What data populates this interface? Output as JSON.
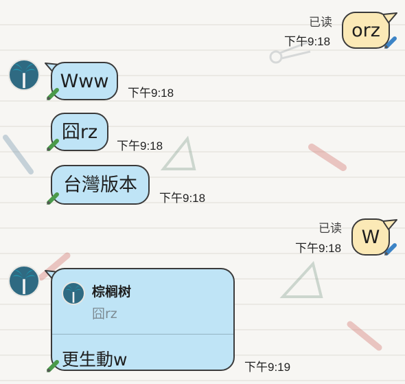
{
  "chat": {
    "messages": [
      {
        "side": "out",
        "text": "orz",
        "read_label": "已读",
        "time": "下午9:18"
      },
      {
        "side": "in",
        "text": "Www",
        "time": "下午9:18"
      },
      {
        "side": "in",
        "text": "囧rz",
        "time": "下午9:18"
      },
      {
        "side": "in",
        "text": "台灣版本",
        "time": "下午9:18"
      },
      {
        "side": "out",
        "text": "W",
        "read_label": "已读",
        "time": "下午9:18"
      },
      {
        "side": "in",
        "reply": {
          "sender": "棕榈树",
          "quoted_text": "囧rz"
        },
        "text": "更生動w",
        "time": "下午9:19"
      }
    ]
  },
  "colors": {
    "incoming_bubble": "#bfe4f6",
    "outgoing_bubble": "#fbe9b6",
    "background": "#f7f6f3",
    "avatar": "#2f6a82"
  },
  "icons": [
    "palm-tree-avatar-icon",
    "pencil-icon"
  ]
}
